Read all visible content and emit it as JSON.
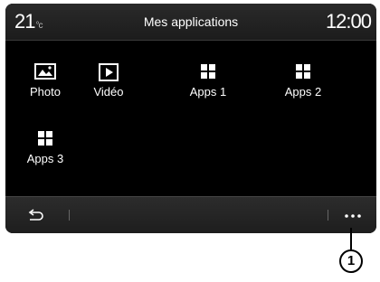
{
  "status_bar": {
    "temperature": "21",
    "temperature_unit": "°c",
    "title": "Mes applications",
    "time": "12:00"
  },
  "apps": [
    {
      "label": "Photo",
      "icon": "photo-icon"
    },
    {
      "label": "Vidéo",
      "icon": "video-icon"
    },
    {
      "label": "Apps 1",
      "icon": "apps-grid-icon"
    },
    {
      "label": "Apps 2",
      "icon": "apps-grid-icon"
    },
    {
      "label": "Apps 3",
      "icon": "apps-grid-icon"
    }
  ],
  "bottom_bar": {
    "back_icon": "back-arrow-icon",
    "more_icon": "more-dots-icon"
  },
  "callout": {
    "number": "1"
  },
  "colors": {
    "screen_bg": "#000000",
    "bar_bg": "#242424",
    "text": "#ffffff"
  }
}
